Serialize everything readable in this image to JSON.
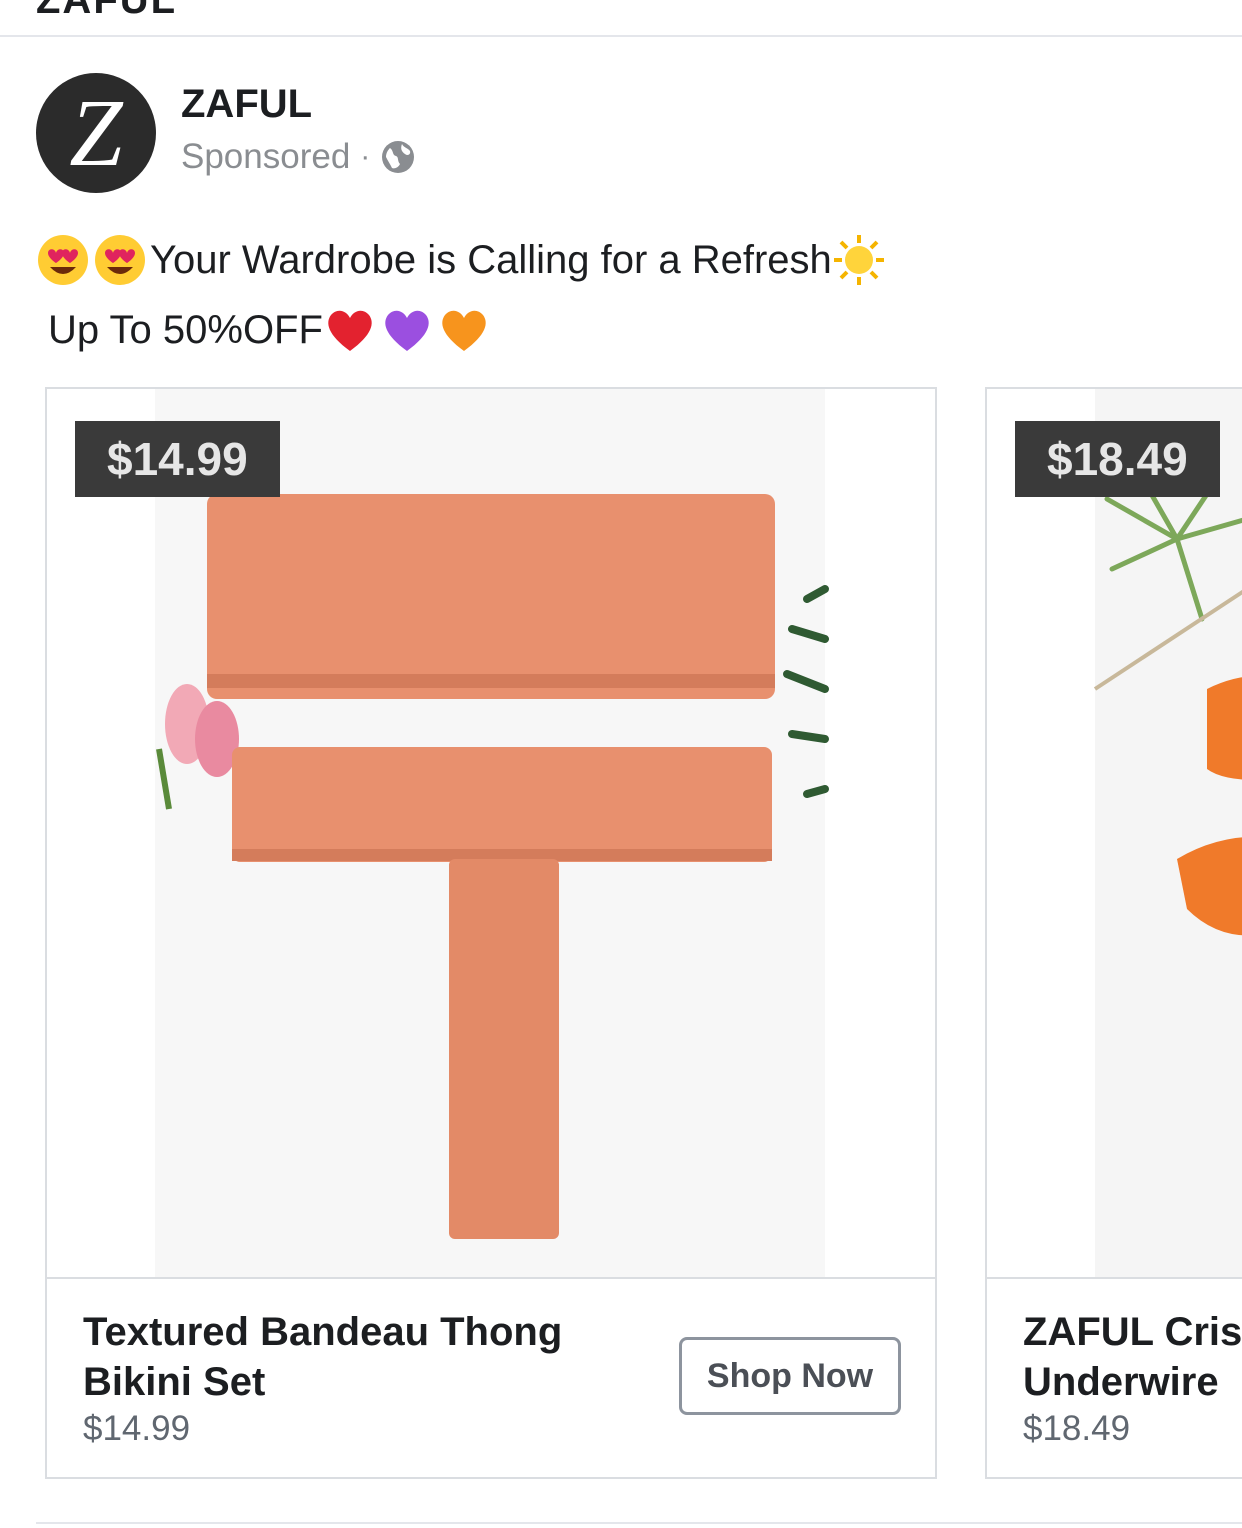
{
  "previous_post": {
    "tail_text": "ZAFUL"
  },
  "post": {
    "page_name": "ZAFUL",
    "avatar_letter": "Z",
    "sponsored_label": "Sponsored",
    "meta_separator": "·",
    "visibility_icon": "globe-icon",
    "caption_line1": "Your Wardrobe is Calling for a Refresh",
    "caption_line1_emojis_before": [
      "heart-eyes-emoji",
      "heart-eyes-emoji"
    ],
    "caption_line1_emoji_after": "sun-emoji",
    "caption_line2": "Up To 50%OFF",
    "caption_line2_emojis_after": [
      "red-heart-emoji",
      "purple-heart-emoji",
      "orange-heart-emoji"
    ]
  },
  "carousel": {
    "cards": [
      {
        "price_badge": "$14.99",
        "title": "Textured Bandeau Thong Bikini Set",
        "price": "$14.99",
        "cta_label": "Shop Now",
        "product_color": "#e8906e"
      },
      {
        "price_badge": "$18.49",
        "title_line1": "ZAFUL Cris",
        "title_line2": "Underwire",
        "price": "$18.49",
        "product_color": "#f07a2a"
      }
    ]
  },
  "colors": {
    "badge_bg": "#3a3a3a",
    "divider": "#e4e6eb",
    "meta_text": "#8a8d91"
  }
}
